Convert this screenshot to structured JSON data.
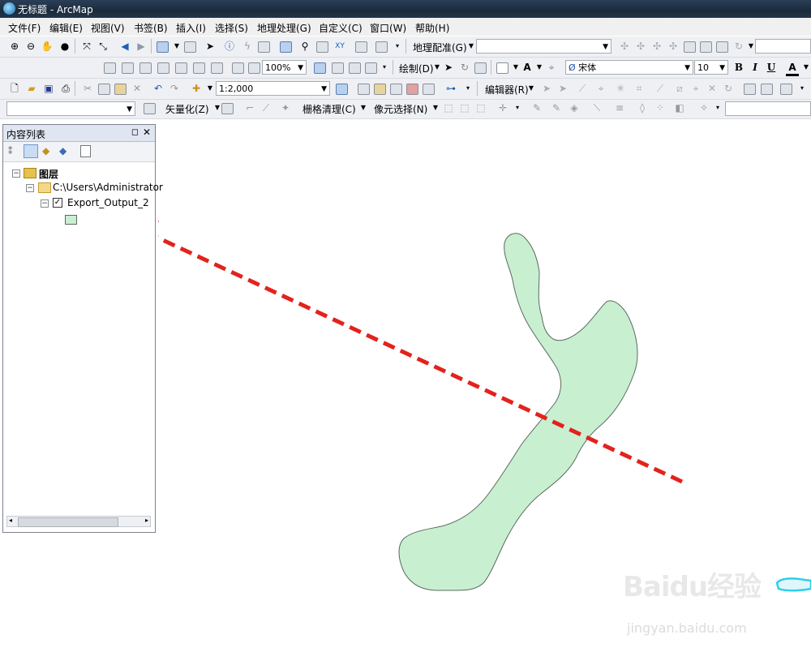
{
  "window": {
    "title": "无标题 - ArcMap"
  },
  "menu": [
    "文件(F)",
    "编辑(E)",
    "视图(V)",
    "书签(B)",
    "插入(I)",
    "选择(S)",
    "地理处理(G)",
    "自定义(C)",
    "窗口(W)",
    "帮助(H)"
  ],
  "toolbars": {
    "georef_label": "地理配准(G)",
    "zoom_value": "100%",
    "draw_label": "绘制(D)",
    "font_name": "宋体",
    "font_size": "10",
    "scale_value": "1:2,000",
    "editor_label": "编辑器(R)",
    "vectorize_label": "矢量化(Z)",
    "raster_cleanup_label": "栅格清理(C)",
    "cell_select_label": "像元选择(N)",
    "bold": "B",
    "italic": "I",
    "underline": "U",
    "font_color_glyph": "A"
  },
  "toc": {
    "title": "内容列表",
    "root_label": "图层",
    "folder_label": "C:\\Users\\Administrator",
    "layer_label": "Export_Output_2",
    "layer_checked": true
  },
  "colors": {
    "polygon_fill": "#c9efd1",
    "polygon_stroke": "#5a6b5e",
    "annotation_arrow": "#e3221c",
    "polygon2_fill": "#dff6fb",
    "polygon2_stroke": "#2ad0ea"
  },
  "watermark": {
    "logo": "Baidu经验",
    "url": "jingyan.baidu.com"
  }
}
